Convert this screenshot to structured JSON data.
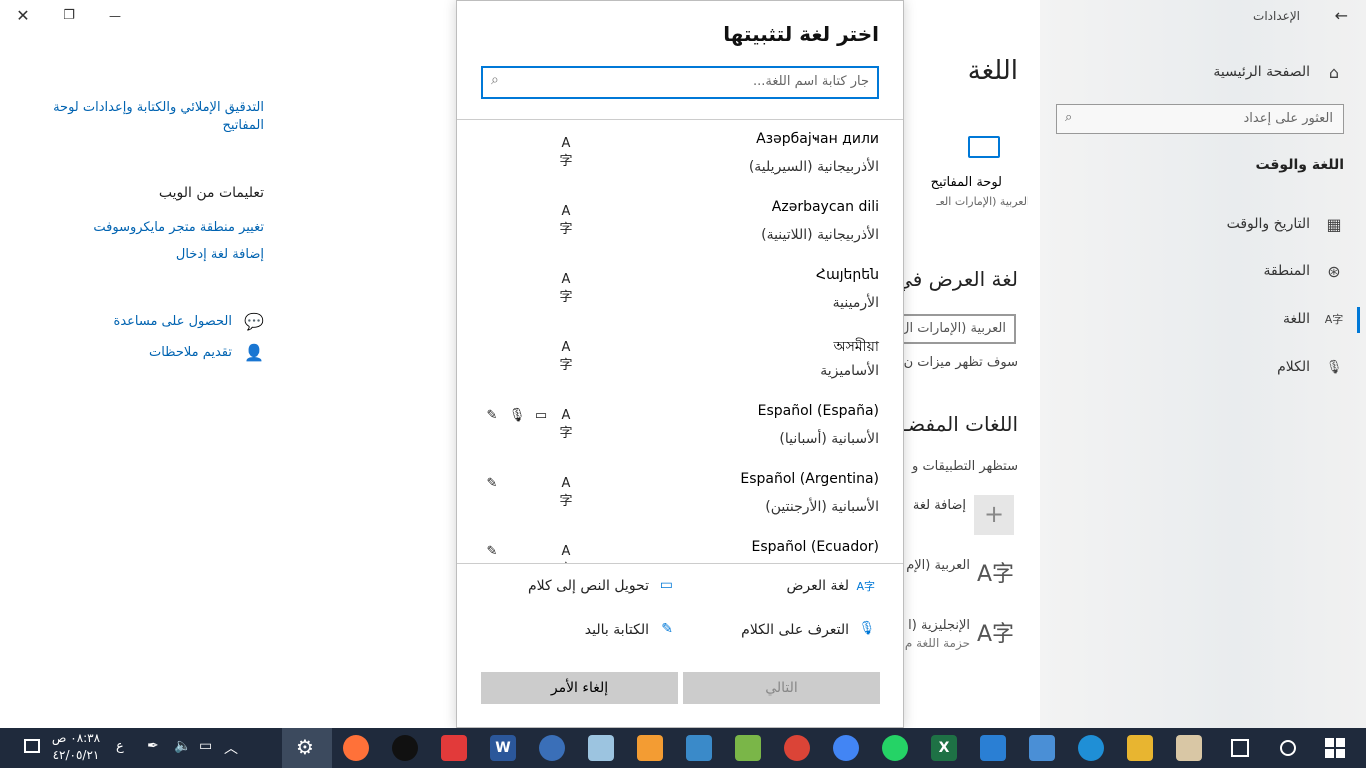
{
  "window": {
    "title": "الإعدادات",
    "close_glyph": "✕",
    "restore_glyph": "❐",
    "minimize_glyph": "—"
  },
  "nav": {
    "back_glyph": "←",
    "home_label": "الصفحة الرئيسية",
    "search_placeholder": "العثور على إعداد",
    "section_title": "اللغة والوقت",
    "items": [
      {
        "label": "التاريخ والوقت",
        "icon": "calendar-clock-icon",
        "glyph": "▦"
      },
      {
        "label": "المنطقة",
        "icon": "globe-icon",
        "glyph": "⊛"
      },
      {
        "label": "اللغة",
        "icon": "language-icon",
        "glyph": "A字"
      },
      {
        "label": "الكلام",
        "icon": "microphone-icon",
        "glyph": "🎙"
      }
    ]
  },
  "main": {
    "page_title": "اللغة",
    "keyboard_label": "لوحة المفاتيح",
    "keyboard_sub": "العربية (الإمارات العـ",
    "display_lang_heading": "لغة العرض في",
    "display_lang_value": "العربية (الإمارات ال",
    "display_lang_note": "سوف تظهر ميزات ن",
    "preferred_heading": "اللغات المفضـ",
    "preferred_note": "ستظهر التطبيقات و",
    "add_lang_label": "إضافة لغة",
    "pref_langs": [
      {
        "name": "العربية (الإم",
        "sub": ""
      },
      {
        "name": "الإنجليزية (ا",
        "sub": "حزمة اللغة م"
      }
    ]
  },
  "related": {
    "spell_link": "التدقيق الإملائي والكتابة وإعدادات لوحة المفاتيح",
    "web_help_heading": "تعليمات من الويب",
    "store_region_link": "تغيير منطقة متجر مايكروسوفت",
    "add_input_lang_link": "إضافة لغة إدخال",
    "get_help": "الحصول على مساعدة",
    "feedback": "تقديم ملاحظات"
  },
  "dialog": {
    "title": "اختر لغة لتثبيتها",
    "search_placeholder": "جار كتابة اسم اللغة...",
    "languages": [
      {
        "native": "Азәрбајҹан дили",
        "arabic": "الأذربيجانية (السيريلية)",
        "features": [
          "display"
        ]
      },
      {
        "native": "Azərbaycan dili",
        "arabic": "الأذربيجانية (اللاتينية)",
        "features": [
          "display"
        ]
      },
      {
        "native": "Հայերեն",
        "arabic": "الأرمينية",
        "features": [
          "display"
        ]
      },
      {
        "native": "অসমীয়া",
        "arabic": "الأساميزية",
        "features": [
          "display"
        ]
      },
      {
        "native": "Español (España)",
        "arabic": "الأسبانية (أسبانيا)",
        "features": [
          "display",
          "tts",
          "speech",
          "handwriting"
        ]
      },
      {
        "native": "Español (Argentina)",
        "arabic": "الأسبانية (الأرجنتين)",
        "features": [
          "display",
          "handwriting"
        ]
      },
      {
        "native": "Español (Ecuador)",
        "arabic": "",
        "features": [
          "display",
          "handwriting"
        ]
      }
    ],
    "legend": {
      "display": "لغة العرض",
      "tts": "تحويل النص إلى كلام",
      "speech": "التعرف على الكلام",
      "handwriting": "الكتابة باليد"
    },
    "next_button": "التالي",
    "cancel_button": "إلغاء الأمر"
  },
  "taskbar": {
    "time": "٠٨:٣٨ ص",
    "date": "٤٢/٠٥/٢١",
    "input_indicator": "ع",
    "accent": "#1f2a3c"
  }
}
